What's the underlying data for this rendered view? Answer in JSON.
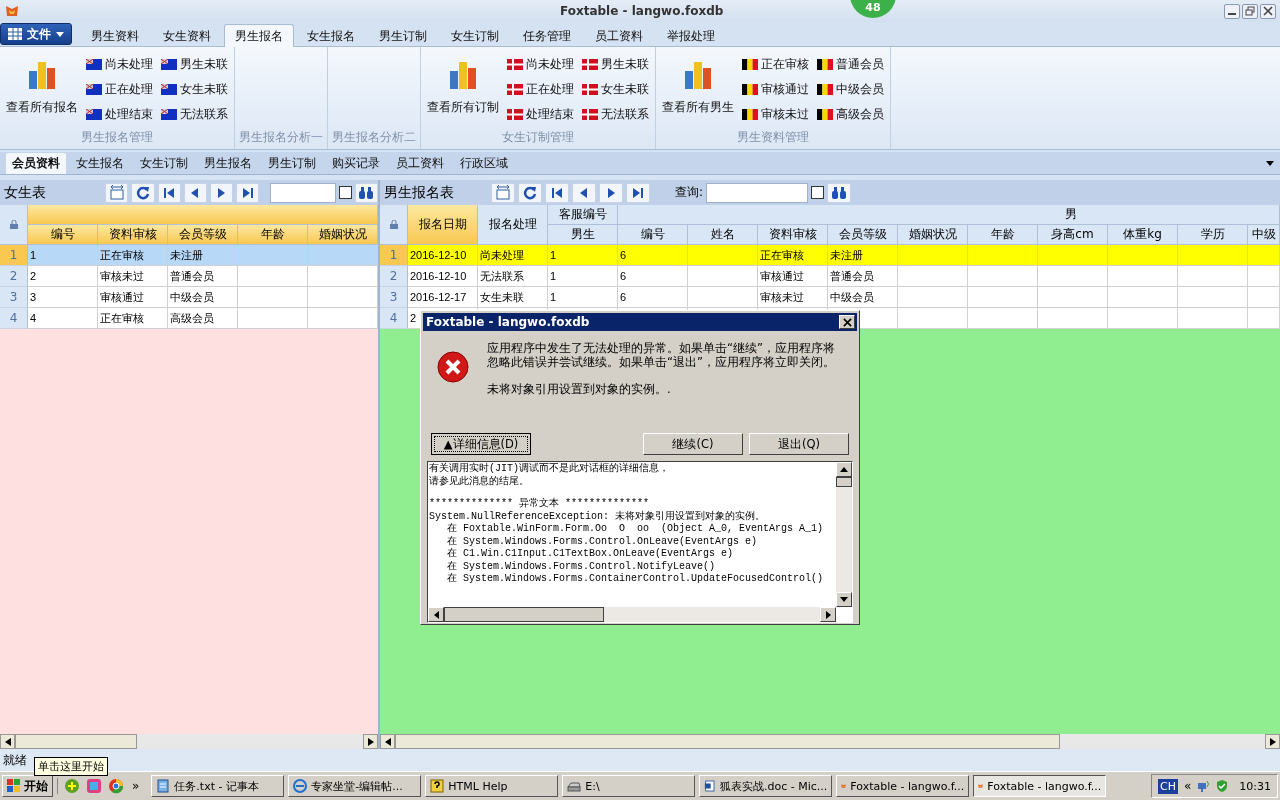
{
  "window": {
    "title": "Foxtable - langwo.foxdb",
    "badge": "48"
  },
  "ribbon": {
    "file_button": "文件",
    "tabs": [
      {
        "label": "男生资料",
        "selected": false
      },
      {
        "label": "女生资料",
        "selected": false
      },
      {
        "label": "男生报名",
        "selected": true
      },
      {
        "label": "女生报名",
        "selected": false
      },
      {
        "label": "男生订制",
        "selected": false
      },
      {
        "label": "女生订制",
        "selected": false
      },
      {
        "label": "任务管理",
        "selected": false
      },
      {
        "label": "员工资料",
        "selected": false
      },
      {
        "label": "举报处理",
        "selected": false
      }
    ],
    "groups": [
      {
        "title": "男生报名管理",
        "big_button": "查看所有报名",
        "kind": "ensign",
        "items": [
          "尚未处理",
          "正在处理",
          "处理结束",
          "男生未联",
          "女生未联",
          "无法联系"
        ]
      },
      {
        "title": "男生报名分析一"
      },
      {
        "title": "男生报名分析二"
      },
      {
        "title": "女生订制管理",
        "big_button": "查看所有订制",
        "kind": "cross",
        "items": [
          "尚未处理",
          "正在处理",
          "处理结束",
          "男生未联",
          "女生未联",
          "无法联系"
        ]
      },
      {
        "title": "男生资料管理",
        "big_button": "查看所有男生",
        "kind": "tricolor",
        "items": [
          "正在审核",
          "审核通过",
          "审核未过",
          "普通会员",
          "中级会员",
          "高级会员"
        ]
      }
    ]
  },
  "sub_tabs": [
    {
      "label": "会员资料",
      "selected": true
    },
    {
      "label": "女生报名",
      "selected": false
    },
    {
      "label": "女生订制",
      "selected": false
    },
    {
      "label": "男生报名",
      "selected": false
    },
    {
      "label": "男生订制",
      "selected": false
    },
    {
      "label": "购买记录",
      "selected": false
    },
    {
      "label": "员工资料",
      "selected": false
    },
    {
      "label": "行政区域",
      "selected": false
    }
  ],
  "left_pane": {
    "title": "女生表",
    "checked": false,
    "columns": [
      "编号",
      "资料审核",
      "会员等级",
      "年龄",
      "婚姻状况"
    ],
    "rows": [
      {
        "number": "1",
        "selected": true,
        "cells": [
          "1",
          "正在审核",
          "未注册"
        ]
      },
      {
        "number": "2",
        "selected": false,
        "cells": [
          "2",
          "审核未过",
          "普通会员"
        ]
      },
      {
        "number": "3",
        "selected": false,
        "cells": [
          "3",
          "审核通过",
          "中级会员"
        ]
      },
      {
        "number": "4",
        "selected": false,
        "cells": [
          "4",
          "正在审核",
          "高级会员"
        ]
      }
    ]
  },
  "right_pane": {
    "title": "男生报名表",
    "search_label": "查询:",
    "checked": false,
    "columns": [
      {
        "label": "报名日期"
      },
      {
        "label": "报名处理"
      },
      {
        "label": "男生",
        "group_start": true
      },
      {
        "label": "编号",
        "group_start": true
      },
      {
        "label": "姓名"
      },
      {
        "label": "资料审核"
      },
      {
        "label": "会员等级"
      },
      {
        "label": "婚姻状况"
      },
      {
        "label": "年龄"
      },
      {
        "label": "身高cm"
      },
      {
        "label": "体重kg"
      },
      {
        "label": "学历"
      },
      {
        "label": "中级"
      }
    ],
    "column_groups": [
      {
        "label": "客服编号"
      },
      {
        "label": "男"
      }
    ],
    "rows": [
      {
        "number": "1",
        "selected": true,
        "highlighted": true,
        "cells": [
          "2016-12-10",
          "尚未处理",
          "1",
          "6",
          "",
          "正在审核",
          "未注册"
        ]
      },
      {
        "number": "2",
        "selected": false,
        "highlighted": false,
        "cells": [
          "2016-12-10",
          "无法联系",
          "1",
          "6",
          "",
          "审核通过",
          "普通会员"
        ]
      },
      {
        "number": "3",
        "selected": false,
        "highlighted": false,
        "cells": [
          "2016-12-17",
          "女生未联",
          "1",
          "6",
          "",
          "审核未过",
          "中级会员"
        ]
      },
      {
        "number": "4",
        "selected": false,
        "highlighted": false,
        "cells": [
          "2"
        ]
      }
    ]
  },
  "status_bar": "就绪",
  "tooltip": "单击这里开始",
  "dialog": {
    "title": "Foxtable - langwo.foxdb",
    "message": "应用程序中发生了无法处理的异常。如果单击“继续”，应用程序将忽略此错误并尝试继续。如果单击“退出”，应用程序将立即关闭。",
    "detail_message": "未将对象引用设置到对象的实例。.",
    "details_button": "▲详细信息(D)",
    "buttons": [
      "继续(C)",
      "退出(Q)"
    ],
    "details": [
      [
        "有关调用实时(JIT)调试而不是此对话框的详细信息，",
        "请参见此消息的结尾。"
      ],
      [
        "************** 异常文本 **************",
        "System.NullReferenceException: 未将对象引用设置到对象的实例。",
        "   在 Foxtable.WinForm.Form.Oo  O  oo  (Object A_0, EventArgs A_1)",
        "   在 System.Windows.Forms.Control.OnLeave(EventArgs e)",
        "   在 C1.Win.C1Input.C1TextBox.OnLeave(EventArgs e)",
        "   在 System.Windows.Forms.Control.NotifyLeave()",
        "   在 System.Windows.Forms.ContainerControl.UpdateFocusedControl()"
      ]
    ]
  },
  "taskbar": {
    "start": "开始",
    "more": "»",
    "tasks": [
      {
        "label": "任务.txt - 记事本",
        "kind": "notepad",
        "selected": false
      },
      {
        "label": "专家坐堂-编辑帖...",
        "kind": "browser",
        "selected": false
      },
      {
        "label": "HTML Help",
        "kind": "help",
        "selected": false
      },
      {
        "label": "E:\\",
        "kind": "drive",
        "selected": false
      },
      {
        "label": "狐表实战.doc - Mic...",
        "kind": "word",
        "selected": false
      },
      {
        "label": "Foxtable - langwo.f...",
        "kind": "app",
        "selected": false
      },
      {
        "label": "Foxtable - langwo.f...",
        "kind": "app",
        "selected": true
      }
    ],
    "language": "CH",
    "tray_more": "«",
    "time": "10:31"
  }
}
